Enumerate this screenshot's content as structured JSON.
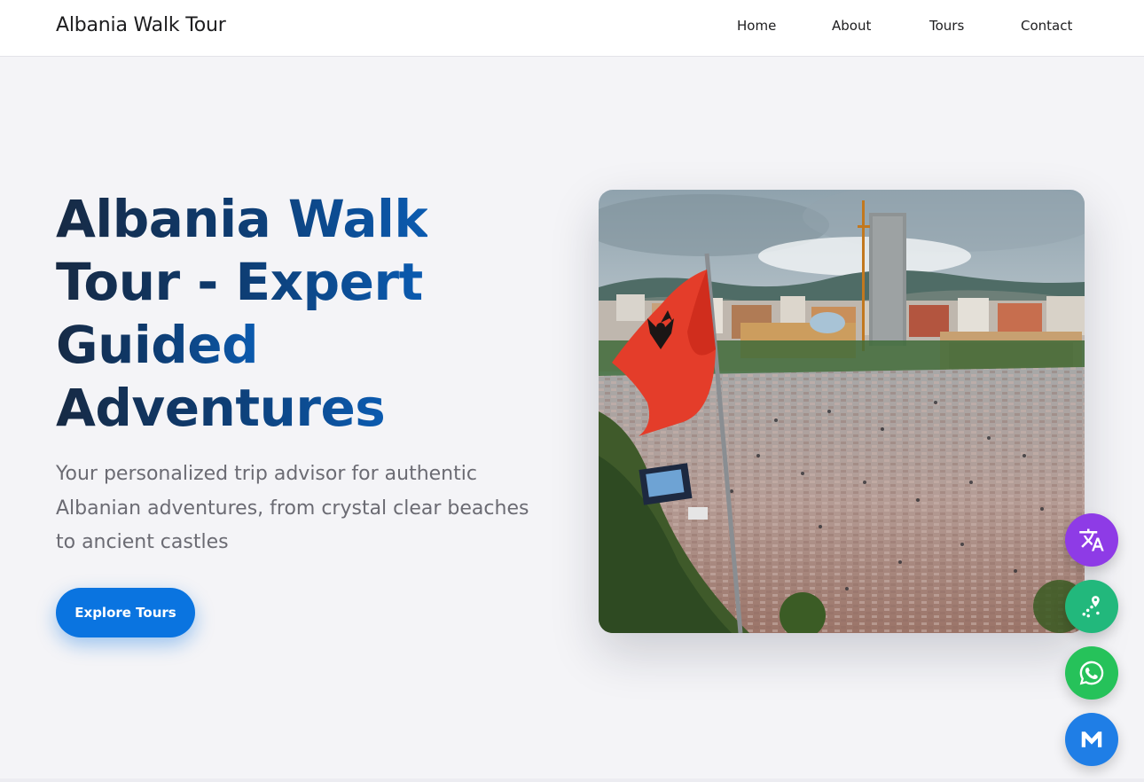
{
  "nav": {
    "brand": "Albania Walk Tour",
    "links": [
      {
        "label": "Home"
      },
      {
        "label": "About"
      },
      {
        "label": "Tours"
      },
      {
        "label": "Contact"
      }
    ]
  },
  "hero": {
    "title_line1": "Albania Walk",
    "title_line2": "Tour - Expert",
    "title_line3": "Guided",
    "title_line4": "Adventures",
    "subtitle": "Your personalized trip advisor for authentic Albanian adventures, from crystal clear beaches to ancient castles",
    "cta_label": "Explore Tours"
  },
  "floating_buttons": [
    {
      "icon": "translate-icon",
      "color": "#8e3be6"
    },
    {
      "icon": "map-icon",
      "color": "#22b87c"
    },
    {
      "icon": "whatsapp-icon",
      "color": "#26c25a"
    },
    {
      "icon": "mail-icon",
      "color": "#1f7ee6"
    }
  ],
  "colors": {
    "accent": "#0a74e0",
    "title_dark": "#172a44",
    "title_blue": "#0b5bb0",
    "background": "#f4f4f7"
  }
}
